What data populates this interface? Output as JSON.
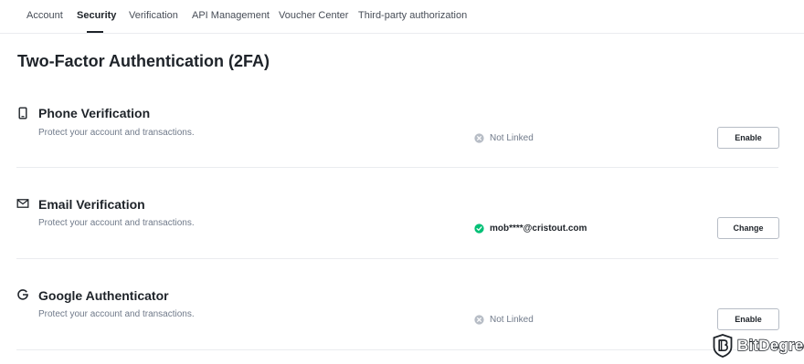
{
  "tabs": [
    {
      "label": "Account"
    },
    {
      "label": "Security"
    },
    {
      "label": "Verification"
    },
    {
      "label": "API Management"
    },
    {
      "label": "Voucher Center"
    },
    {
      "label": "Third-party authorization"
    }
  ],
  "active_tab": "Security",
  "page_title": "Two-Factor Authentication (2FA)",
  "methods": [
    {
      "icon": "phone-icon",
      "title": "Phone Verification",
      "description": "Protect your account and transactions.",
      "status": "Not Linked",
      "status_icon": "x-circle-icon",
      "button": "Enable"
    },
    {
      "icon": "mail-icon",
      "title": "Email Verification",
      "description": "Protect your account and transactions.",
      "status": "mob****@cristout.com",
      "status_icon": "check-circle-icon",
      "button": "Change"
    },
    {
      "icon": "google-icon",
      "title": "Google Authenticator",
      "description": "Protect your account and transactions.",
      "status": "Not Linked",
      "status_icon": "x-circle-icon",
      "button": "Enable"
    }
  ],
  "colors": {
    "text_primary": "#1e2329",
    "text_secondary": "#707a8a",
    "success": "#02c076",
    "muted_icon": "#b7bdc6",
    "divider": "#eaecef"
  },
  "watermark": {
    "text": "BitDegree"
  }
}
